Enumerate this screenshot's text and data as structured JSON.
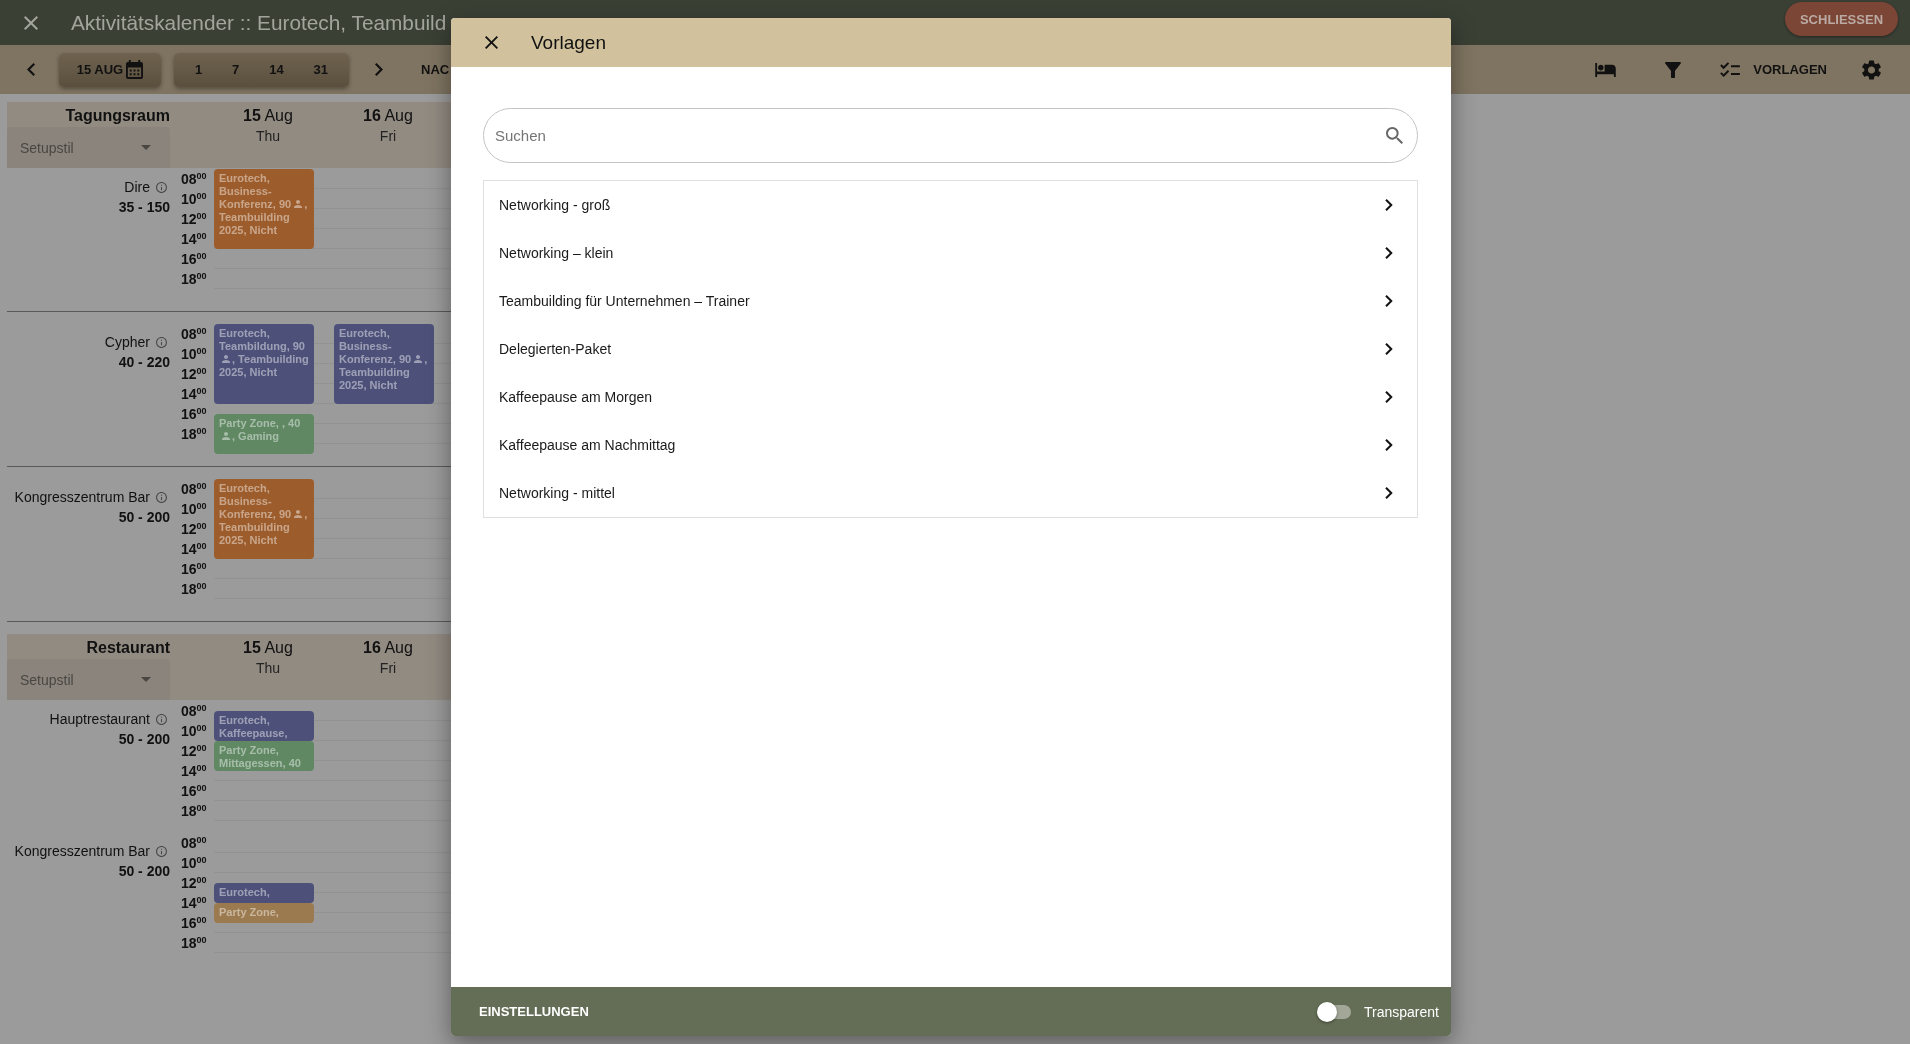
{
  "window": {
    "title": "Aktivitätskalender :: Eurotech, Teambuild",
    "close_button": "SCHLIESSEN"
  },
  "toolbar": {
    "date_button": "15 AUG",
    "ranges": [
      "1",
      "7",
      "14",
      "31"
    ],
    "next_label": "NAC",
    "templates_button": "VORLAGEN"
  },
  "calendar": {
    "sections": [
      {
        "title": "Tagungsraum",
        "setup_style": {
          "placeholder": "Setupstil"
        },
        "room_dividers": true,
        "days": [
          {
            "date": "**15** Aug",
            "weekday": "Thu"
          },
          {
            "date": "**16** Aug",
            "weekday": "Fri"
          }
        ],
        "rooms": [
          {
            "name": "Dire",
            "capacity": "35 - 150",
            "times": [
              "08$^{00}$",
              "10$^{00}$",
              "12$^{00}$",
              "14$^{00}$",
              "16$^{00}$",
              "18$^{00}$"
            ],
            "days": [
              {
                "events": [
                  {
                    "segments": [
                      "Eurotech, Business-Konferenz, 90",
                      ", Teambuilding 2025, Nicht"
                    ],
                    "color": "#9c5c2b"
                  }
                ]
              }
            ]
          },
          {
            "name": "Cypher",
            "capacity": "40 - 220",
            "times": [
              "08$^{00}$",
              "10$^{00}$",
              "12$^{00}$",
              "14$^{00}$",
              "16$^{00}$",
              "18$^{00}$"
            ],
            "days": [
              {
                "events": [
                  {
                    "segments": [
                      "Eurotech, Teambildung, 90",
                      ", Teambuilding 2025, Nicht"
                    ],
                    "color": "#4d5179"
                  },
                  {
                    "segments": [
                      "Party Zone, , 40",
                      ", Gaming"
                    ],
                    "color": "#5f8863"
                  }
                ]
              },
              {
                "events": [
                  {
                    "segments": [
                      "Eurotech, Business-Konferenz, 90",
                      ", Teambuilding 2025, Nicht"
                    ],
                    "color": "#4d5179"
                  }
                ]
              }
            ]
          },
          {
            "name": "Kongresszentrum Bar",
            "capacity": "50 - 200",
            "times": [
              "08$^{00}$",
              "10$^{00}$",
              "12$^{00}$",
              "14$^{00}$",
              "16$^{00}$",
              "18$^{00}$"
            ],
            "days": [
              {
                "events": [
                  {
                    "segments": [
                      "Eurotech, Business-Konferenz, 90",
                      ", Teambuilding 2025, Nicht"
                    ],
                    "color": "#9c5c2b"
                  }
                ]
              }
            ]
          }
        ]
      },
      {
        "title": "Restaurant",
        "setup_style": {
          "placeholder": "Setupstil"
        },
        "room_dividers": false,
        "days": [
          {
            "date": "**15** Aug",
            "weekday": "Thu"
          },
          {
            "date": "**16** Aug",
            "weekday": "Fri"
          }
        ],
        "rooms": [
          {
            "name": "Hauptrestaurant",
            "capacity": "50 - 200",
            "times": [
              "08$^{00}$",
              "10$^{00}$",
              "12$^{00}$",
              "14$^{00}$",
              "16$^{00}$",
              "18$^{00}$"
            ],
            "days": [
              {
                "events": [
                  {
                    "segments": [
                      "Eurotech, Kaffeepause,"
                    ],
                    "color": "#4d5179"
                  },
                  {
                    "segments": [
                      "Party Zone, Mittagessen, 40"
                    ],
                    "color": "#5f8863"
                  }
                ]
              }
            ]
          },
          {
            "name": "Kongresszentrum Bar",
            "capacity": "50 - 200",
            "times": [
              "08$^{00}$",
              "10$^{00}$",
              "12$^{00}$",
              "14$^{00}$",
              "16$^{00}$",
              "18$^{00}$"
            ],
            "days": [
              {
                "events": [
                  {
                    "segments": [
                      "Eurotech,"
                    ],
                    "color": "#4d5179"
                  },
                  {
                    "segments": [
                      "Party Zone,"
                    ],
                    "color": "#9c7a4f"
                  }
                ]
              }
            ]
          }
        ]
      }
    ]
  },
  "dialog": {
    "title": "Vorlagen",
    "search": {
      "placeholder": "Suchen"
    },
    "items": [
      "Networking - groß",
      "Networking – klein",
      "Teambuilding für Unternehmen – Trainer",
      "Delegierten-Paket",
      "Kaffeepause am Morgen",
      "Kaffeepause am Nachmittag",
      "Networking - mittel"
    ],
    "footer": {
      "settings_button": "EINSTELLUNGEN",
      "transparent": {
        "label": "Transparent",
        "on": false
      }
    }
  }
}
